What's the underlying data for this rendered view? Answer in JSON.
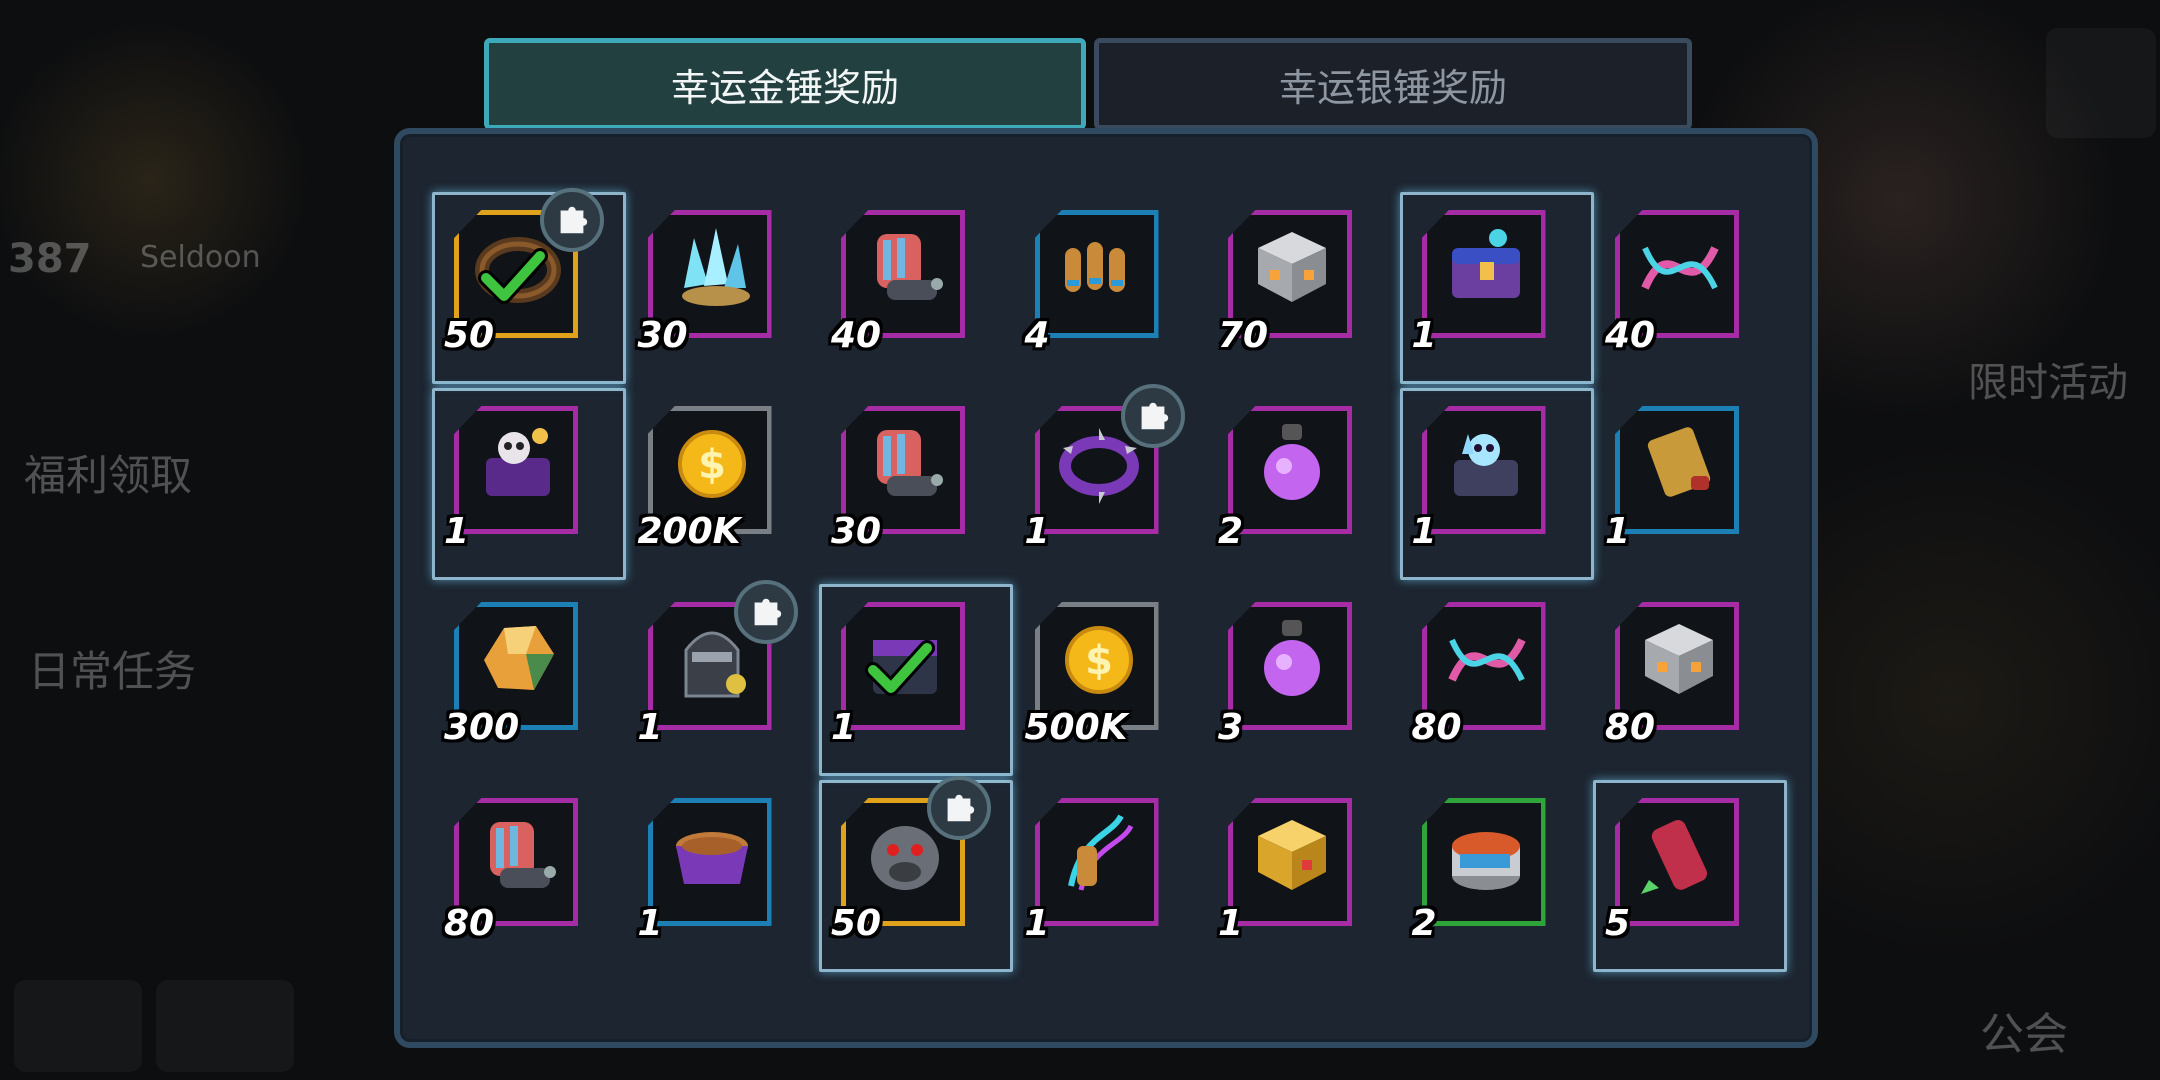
{
  "tabs": [
    {
      "label": "幸运金锤奖励",
      "active": true
    },
    {
      "label": "幸运银锤奖励",
      "active": false
    }
  ],
  "background_labels": {
    "level": "387",
    "player_name": "Seldoon",
    "welfare": "福利领取",
    "daily_tasks": "日常任务",
    "limited_event": "限时活动",
    "guild": "公会"
  },
  "rewards": [
    {
      "qty": "50",
      "icon": "chain-collar-icon",
      "frame": "gold",
      "puzzle": true,
      "claimed": true,
      "highlight": true
    },
    {
      "qty": "30",
      "icon": "crystal-cluster-icon",
      "frame": "purple",
      "puzzle": false,
      "claimed": false
    },
    {
      "qty": "40",
      "icon": "spiked-gauntlet-icon",
      "frame": "purple",
      "puzzle": false,
      "claimed": false
    },
    {
      "qty": "4",
      "icon": "bullets-icon",
      "frame": "blue",
      "puzzle": false,
      "claimed": false
    },
    {
      "qty": "70",
      "icon": "silver-cube-icon",
      "frame": "purple",
      "puzzle": false,
      "claimed": false
    },
    {
      "qty": "1",
      "icon": "treasure-chest-icon",
      "frame": "purple",
      "puzzle": false,
      "claimed": false,
      "highlight": true
    },
    {
      "qty": "40",
      "icon": "dna-helix-icon",
      "frame": "purple",
      "puzzle": false,
      "claimed": false
    },
    {
      "qty": "1",
      "icon": "skull-chest-icon",
      "frame": "purple",
      "puzzle": false,
      "claimed": false,
      "highlight": true
    },
    {
      "qty": "200K",
      "icon": "gold-coin-icon",
      "frame": "gray",
      "puzzle": false,
      "claimed": false
    },
    {
      "qty": "30",
      "icon": "spiked-gauntlet-icon",
      "frame": "purple",
      "puzzle": false,
      "claimed": false
    },
    {
      "qty": "1",
      "icon": "spiked-collar-icon",
      "frame": "purple",
      "puzzle": true,
      "claimed": false
    },
    {
      "qty": "2",
      "icon": "purple-potion-icon",
      "frame": "purple",
      "puzzle": false,
      "claimed": false
    },
    {
      "qty": "1",
      "icon": "ice-skull-chest-icon",
      "frame": "purple",
      "puzzle": false,
      "claimed": false,
      "highlight": true
    },
    {
      "qty": "1",
      "icon": "scroll-icon",
      "frame": "blue",
      "puzzle": false,
      "claimed": false
    },
    {
      "qty": "300",
      "icon": "amber-gem-icon",
      "frame": "blue",
      "puzzle": false,
      "claimed": false
    },
    {
      "qty": "1",
      "icon": "masked-hero-icon",
      "frame": "purple",
      "puzzle": true,
      "claimed": false
    },
    {
      "qty": "1",
      "icon": "dark-chest-icon",
      "frame": "purple",
      "puzzle": false,
      "claimed": true,
      "highlight": true
    },
    {
      "qty": "500K",
      "icon": "gold-coin-icon",
      "frame": "gray",
      "puzzle": false,
      "claimed": false
    },
    {
      "qty": "3",
      "icon": "purple-potion-icon",
      "frame": "purple",
      "puzzle": false,
      "claimed": false
    },
    {
      "qty": "80",
      "icon": "dna-helix-icon",
      "frame": "purple",
      "puzzle": false,
      "claimed": false
    },
    {
      "qty": "80",
      "icon": "silver-cube-icon",
      "frame": "purple",
      "puzzle": false,
      "claimed": false
    },
    {
      "qty": "80",
      "icon": "spiked-gauntlet-icon",
      "frame": "purple",
      "puzzle": false,
      "claimed": false
    },
    {
      "qty": "1",
      "icon": "pet-food-bowl-icon",
      "frame": "blue",
      "puzzle": false,
      "claimed": false
    },
    {
      "qty": "50",
      "icon": "bulldog-head-icon",
      "frame": "gold",
      "puzzle": true,
      "claimed": false,
      "highlight": true
    },
    {
      "qty": "1",
      "icon": "neon-tentacle-icon",
      "frame": "purple",
      "puzzle": false,
      "claimed": false
    },
    {
      "qty": "1",
      "icon": "gold-cube-icon",
      "frame": "purple",
      "puzzle": false,
      "claimed": false
    },
    {
      "qty": "2",
      "icon": "food-can-icon",
      "frame": "green",
      "puzzle": false,
      "claimed": false
    },
    {
      "qty": "5",
      "icon": "red-scroll-icon",
      "frame": "purple",
      "puzzle": false,
      "claimed": false,
      "highlight": true
    }
  ],
  "colors": {
    "frame_purple": "#a62ca6",
    "frame_blue": "#1c80b5",
    "frame_gray": "#7a7e85",
    "frame_gold": "#e0a21a",
    "frame_green": "#2ea43b",
    "tab_active_border": "#3ea9b8"
  }
}
